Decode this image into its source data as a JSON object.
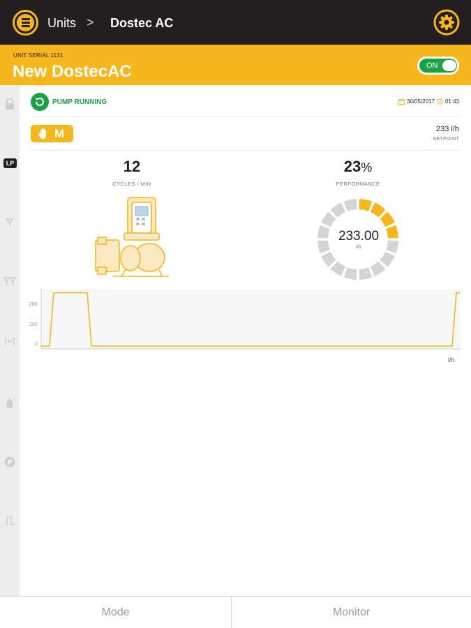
{
  "header": {
    "breadcrumb_units": "Units",
    "breadcrumb_separator": ">",
    "breadcrumb_current": "Dostec AC"
  },
  "unit": {
    "serial_label": "UNIT SERIAL 1131",
    "name": "New DostecAC",
    "power_toggle_label": "ON",
    "power_on": true
  },
  "status": {
    "text": "PUMP RUNNING",
    "date": "30/05/2017",
    "time": "01:43"
  },
  "mode": {
    "letter": "M",
    "setpoint_value": "233 l/h",
    "setpoint_label": "SETPOINT"
  },
  "metrics": {
    "cycles_value": "12",
    "cycles_label": "CYCLES / MIN",
    "performance_value": "23",
    "performance_unit": "%",
    "performance_label": "PERFORMANCE",
    "performance_fraction": 0.23
  },
  "gauge": {
    "value": "233.00",
    "unit": "l/h",
    "segments_total": 16,
    "segments_active": 4
  },
  "chart_data": {
    "type": "line",
    "y_tick_labels": [
      "200",
      "100",
      "0"
    ],
    "unit": "l/h",
    "ylim": [
      0,
      250
    ],
    "x": [
      0,
      2,
      3,
      11,
      12,
      98,
      99,
      100
    ],
    "y": [
      0,
      0,
      233,
      233,
      0,
      0,
      233,
      233
    ]
  },
  "tabs": {
    "mode": "Mode",
    "monitor": "Monitor"
  },
  "colors": {
    "brand_yellow": "#f5b71b",
    "topbar": "#231f20",
    "status_green": "#1aa245",
    "gauge_inactive": "#d4d4d4"
  },
  "sidebar_icons": [
    "lock-icon",
    "lp-mode-icon",
    "filter-icon",
    "double-filter-icon",
    "level-icon",
    "drop-icon",
    "parking-icon",
    "pulse-icon"
  ]
}
